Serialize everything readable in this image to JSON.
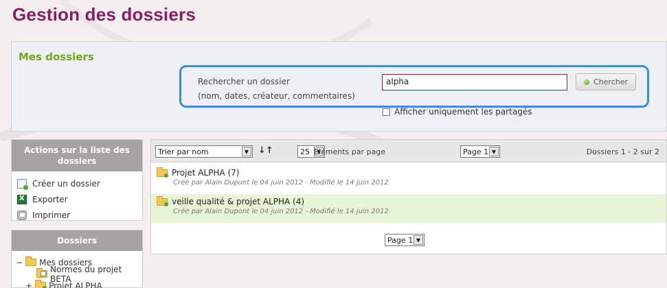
{
  "page_title": "Gestion des dossiers",
  "search": {
    "section_title": "Mes dossiers",
    "label": "Rechercher un dossier",
    "sublabel": "(nom, dates, créateur, commentaires)",
    "value": "alpha",
    "button_label": "Chercher",
    "shared_only_label": "Afficher uniquement les partagés"
  },
  "actions": {
    "title": "Actions sur la liste des dossiers",
    "items": [
      {
        "label": "Créer un dossier",
        "icon": "new-document-icon"
      },
      {
        "label": "Exporter",
        "icon": "excel-icon"
      },
      {
        "label": "Imprimer",
        "icon": "printer-icon"
      }
    ]
  },
  "folders_tree": {
    "title": "Dossiers",
    "root": "Mes dossiers",
    "children": [
      "Normes du projet BETA",
      "Projet ALPHA"
    ]
  },
  "list": {
    "sort_select": "Trier par nom",
    "per_page_value": "25",
    "per_page_label": "Eléments par page",
    "page_select": "Page 1",
    "count": "Dossiers 1 - 2 sur 2",
    "rows": [
      {
        "title": "Projet ALPHA (7)",
        "meta": "Créé par Alain Dupont le 04 juin 2012 - Modifié le 14 juin 2012"
      },
      {
        "title": "veille qualité & projet ALPHA (4)",
        "meta": "Créé par Alain Dupont le 04 juin 2012 - Modifié le 14 juin 2012"
      }
    ],
    "page_bottom": "Page 1"
  },
  "colors": {
    "title": "#8a1b6a",
    "accent_green": "#74a51e",
    "search_highlight": "#3a8ddd",
    "selected_row": "#e7f5d6"
  }
}
